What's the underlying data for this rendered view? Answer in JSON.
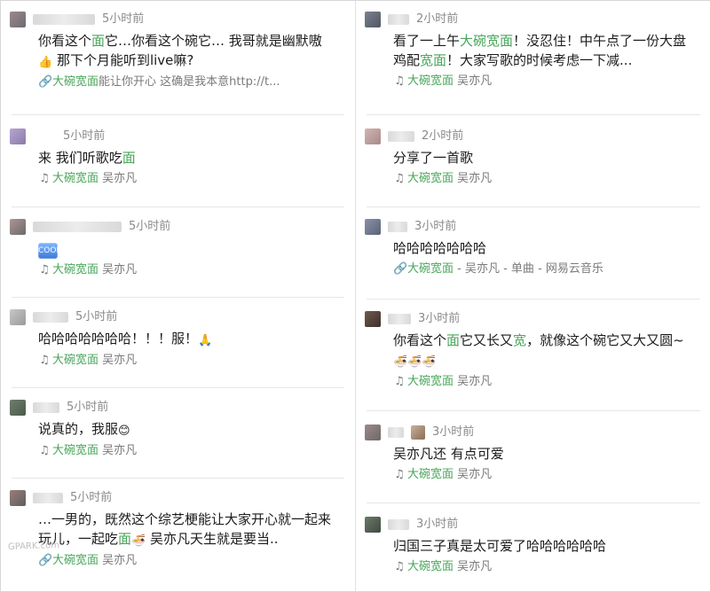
{
  "left": {
    "items": [
      {
        "time": "5小时前",
        "content_parts": [
          "你看这个",
          "面",
          "它…你看这个碗它… 我哥就是幽默嗷",
          "👍",
          " 那下个月能听到live嘛?"
        ],
        "footer": {
          "icon": "🔗",
          "song": "大碗宽面",
          "rest": "能让你开心 这确是我本意http://t..."
        }
      },
      {
        "time": "5小时前",
        "content_parts": [
          "来 我们听歌吃",
          "面"
        ],
        "footer": {
          "icon": "♫",
          "song": "大碗宽面",
          "rest": "吴亦凡"
        }
      },
      {
        "time": "5小时前",
        "content_parts": [
          "COOL"
        ],
        "footer": {
          "icon": "♫",
          "song": "大碗宽面",
          "rest": "吴亦凡"
        }
      },
      {
        "time": "5小时前",
        "content_parts": [
          "哈哈哈哈哈哈哈！！！服！",
          " 🙏"
        ],
        "footer": {
          "icon": "♫",
          "song": "大碗宽面",
          "rest": "吴亦凡"
        }
      },
      {
        "time": "5小时前",
        "content_parts": [
          "说真的，我服",
          "😊"
        ],
        "footer": {
          "icon": "♫",
          "song": "大碗宽面",
          "rest": "吴亦凡"
        }
      },
      {
        "time": "5小时前",
        "content_parts": [
          "…一男的，既然这个综艺梗能让大家开心就一起来玩儿，一起吃",
          "面",
          "🍜",
          " 吴亦凡天生就是要当.."
        ],
        "footer": {
          "icon": "🔗",
          "song": "大碗宽面",
          "rest": "吴亦凡"
        }
      }
    ]
  },
  "right": {
    "items": [
      {
        "time": "2小时前",
        "content_parts": [
          "看了一上午",
          "大碗宽面",
          "！没忍住！中午点了一份大盘鸡配",
          "宽面",
          "！大家写歌的时候考虑一下减..."
        ],
        "footer": {
          "icon": "♫",
          "song": "大碗宽面",
          "rest": "吴亦凡"
        }
      },
      {
        "time": "2小时前",
        "content_parts": [
          "分享了一首歌"
        ],
        "footer": {
          "icon": "♫",
          "song": "大碗宽面",
          "rest": "吴亦凡"
        }
      },
      {
        "time": "3小时前",
        "content_parts": [
          "哈哈哈哈哈哈哈"
        ],
        "footer": {
          "icon": "🔗",
          "song": "大碗宽面",
          "rest": "- 吴亦凡 - 单曲 - 网易云音乐"
        }
      },
      {
        "time": "3小时前",
        "content_parts": [
          "你看这个",
          "面",
          "它又长又",
          "宽",
          "，就像这个碗它又大又圆~",
          "🍜🍜🍜"
        ],
        "footer": {
          "icon": "♫",
          "song": "大碗宽面",
          "rest": "吴亦凡"
        }
      },
      {
        "time": "3小时前",
        "content_parts": [
          "吴亦凡还 有点可爱"
        ],
        "footer": {
          "icon": "♫",
          "song": "大碗宽面",
          "rest": "吴亦凡"
        }
      },
      {
        "time": "3小时前",
        "content_parts": [
          "归国三子真是太可爱了哈哈哈哈哈哈"
        ],
        "footer": {
          "icon": "♫",
          "song": "大碗宽面",
          "rest": "吴亦凡"
        }
      }
    ]
  },
  "watermark": "GPARK.com",
  "colors": {
    "accent_green": "#48a65a",
    "muted": "#8a8a8a"
  }
}
